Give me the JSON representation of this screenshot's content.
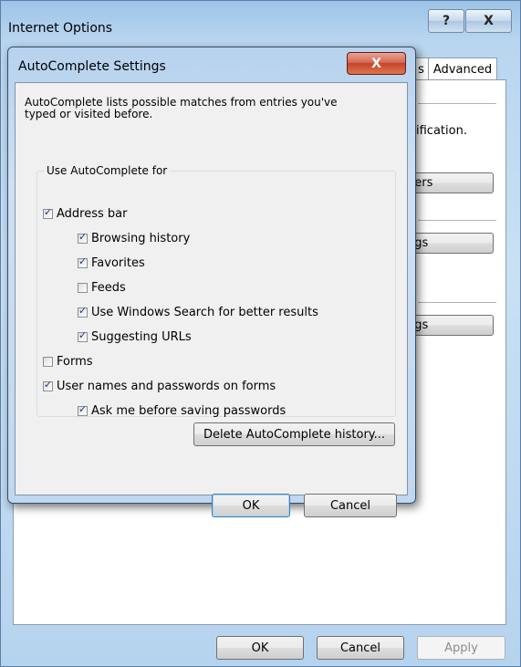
{
  "outer_window": {
    "title": "Internet Options",
    "help_glyph": "?",
    "close_glyph": "X",
    "tabs": {
      "programs_fragment": "s",
      "advanced": "Advanced"
    },
    "fragments": {
      "certificates_text": "ification.",
      "publishers_button": "hers",
      "settings_button_1": "ngs",
      "settings_button_2": "ngs"
    },
    "buttons": {
      "ok": "OK",
      "cancel": "Cancel",
      "apply": "Apply"
    }
  },
  "dialog": {
    "title": "AutoComplete Settings",
    "close_glyph": "X",
    "description": "AutoComplete lists possible matches from entries you've typed or visited before.",
    "group_label": "Use AutoComplete for",
    "checkboxes": {
      "address_bar": {
        "label": "Address bar",
        "checked": true
      },
      "browsing_history": {
        "label": "Browsing history",
        "checked": true
      },
      "favorites": {
        "label": "Favorites",
        "checked": true
      },
      "feeds": {
        "label": "Feeds",
        "checked": false
      },
      "windows_search": {
        "label": "Use Windows Search for better results",
        "checked": true
      },
      "suggesting_urls": {
        "label": "Suggesting URLs",
        "checked": true
      },
      "forms": {
        "label": "Forms",
        "checked": false
      },
      "user_names": {
        "label": "User names and passwords on forms",
        "checked": true
      },
      "ask_before_saving": {
        "label": "Ask me before saving passwords",
        "checked": true
      }
    },
    "delete_history_button": "Delete AutoComplete history...",
    "ok_button": "OK",
    "cancel_button": "Cancel"
  }
}
